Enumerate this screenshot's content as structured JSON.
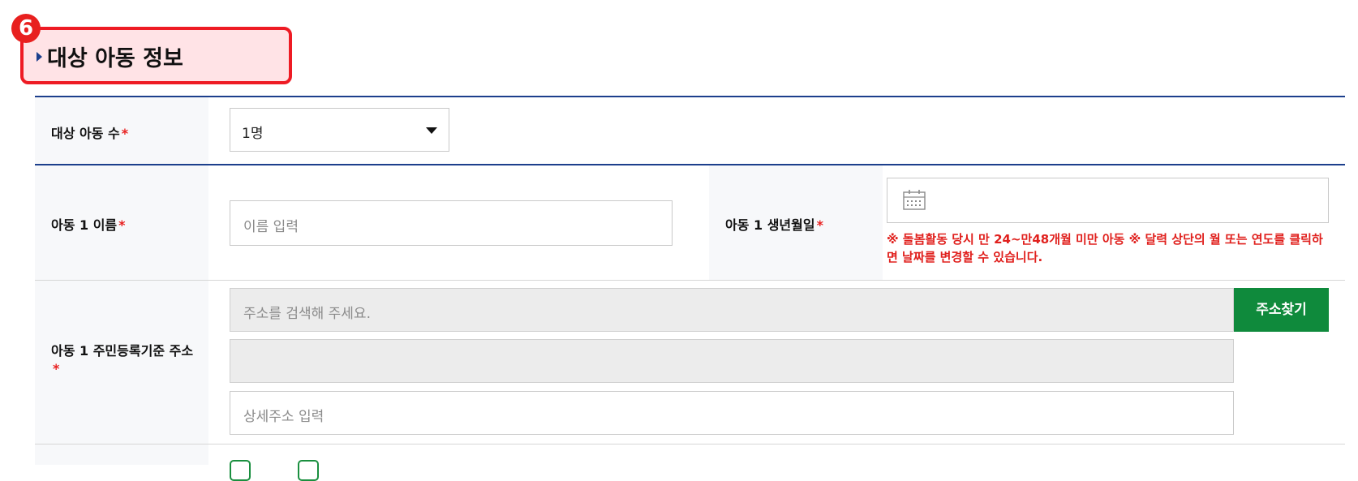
{
  "step_badge": "6",
  "section": {
    "title": "대상 아동 정보"
  },
  "children_count": {
    "label": "대상 아동 수",
    "required": "*",
    "selected": "1명"
  },
  "child1": {
    "name_label": "아동 1 이름",
    "name_placeholder": "이름 입력",
    "birth_label": "아동 1 생년월일",
    "birth_note": "※ 돌봄활동 당시 만 24~만48개월 미만 아동 ※ 달력 상단의 월 또는 연도를 클릭하면 날짜를 변경할 수 있습니다.",
    "address_label": "아동 1 주민등록기준 주소",
    "address_placeholder": "주소를 검색해 주세요.",
    "address_search_button": "주소찾기",
    "address_detail_placeholder": "상세주소 입력"
  },
  "required_mark": "*",
  "colors": {
    "accent_red": "#e8201f",
    "highlight_bg": "#ffe3e6",
    "navy": "#1c3f8c",
    "button_green": "#0f8a3c"
  },
  "icons": [
    "caret-down-icon",
    "calendar-icon",
    "checkbox-icon"
  ]
}
